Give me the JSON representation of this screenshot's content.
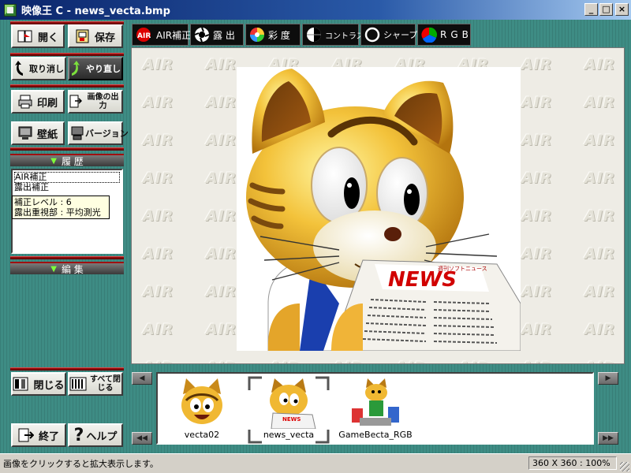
{
  "window": {
    "title": "映像王 C - news_vecta.bmp",
    "controls": [
      "_",
      "□",
      "×"
    ]
  },
  "toolbar_left": {
    "open": "開く",
    "save": "保存",
    "undo": "取り消し",
    "redo": "やり直し",
    "print": "印刷",
    "export": "画像の出力",
    "wallpaper": "壁紙",
    "version": "バージョン"
  },
  "sections": {
    "history": "履 歴",
    "edit": "編 集"
  },
  "history": {
    "items": [
      "AIR補正",
      "露出補正"
    ],
    "tooltip": [
      "補正レベル : 6",
      "露出重視部 : 平均測光"
    ]
  },
  "tabs": [
    {
      "label": "AIR補正",
      "icon": "air-logo-icon"
    },
    {
      "label": "露 出",
      "icon": "aperture-icon"
    },
    {
      "label": "彩 度",
      "icon": "color-wheel-icon"
    },
    {
      "label": "コントラスト",
      "icon": "contrast-icon"
    },
    {
      "label": "シャープ",
      "icon": "sharpen-icon"
    },
    {
      "label": "RGB",
      "icon": "rgb-icon"
    }
  ],
  "canvas": {
    "watermark": "AIR"
  },
  "image": {
    "newspaper_headline": "NEWS",
    "newspaper_masthead": "週刊ソフトニュース"
  },
  "bottom_left": {
    "close": "閉じる",
    "close_all": "すべて閉じる",
    "exit": "終了",
    "help": "ヘルプ"
  },
  "thumbnails": [
    {
      "name": "vecta02"
    },
    {
      "name": "news_vecta",
      "selected": true
    },
    {
      "name": "GameBecta_RGB"
    }
  ],
  "status": {
    "message": "画像をクリックすると拡大表示します。",
    "size": "360 X 360 : 100%"
  }
}
